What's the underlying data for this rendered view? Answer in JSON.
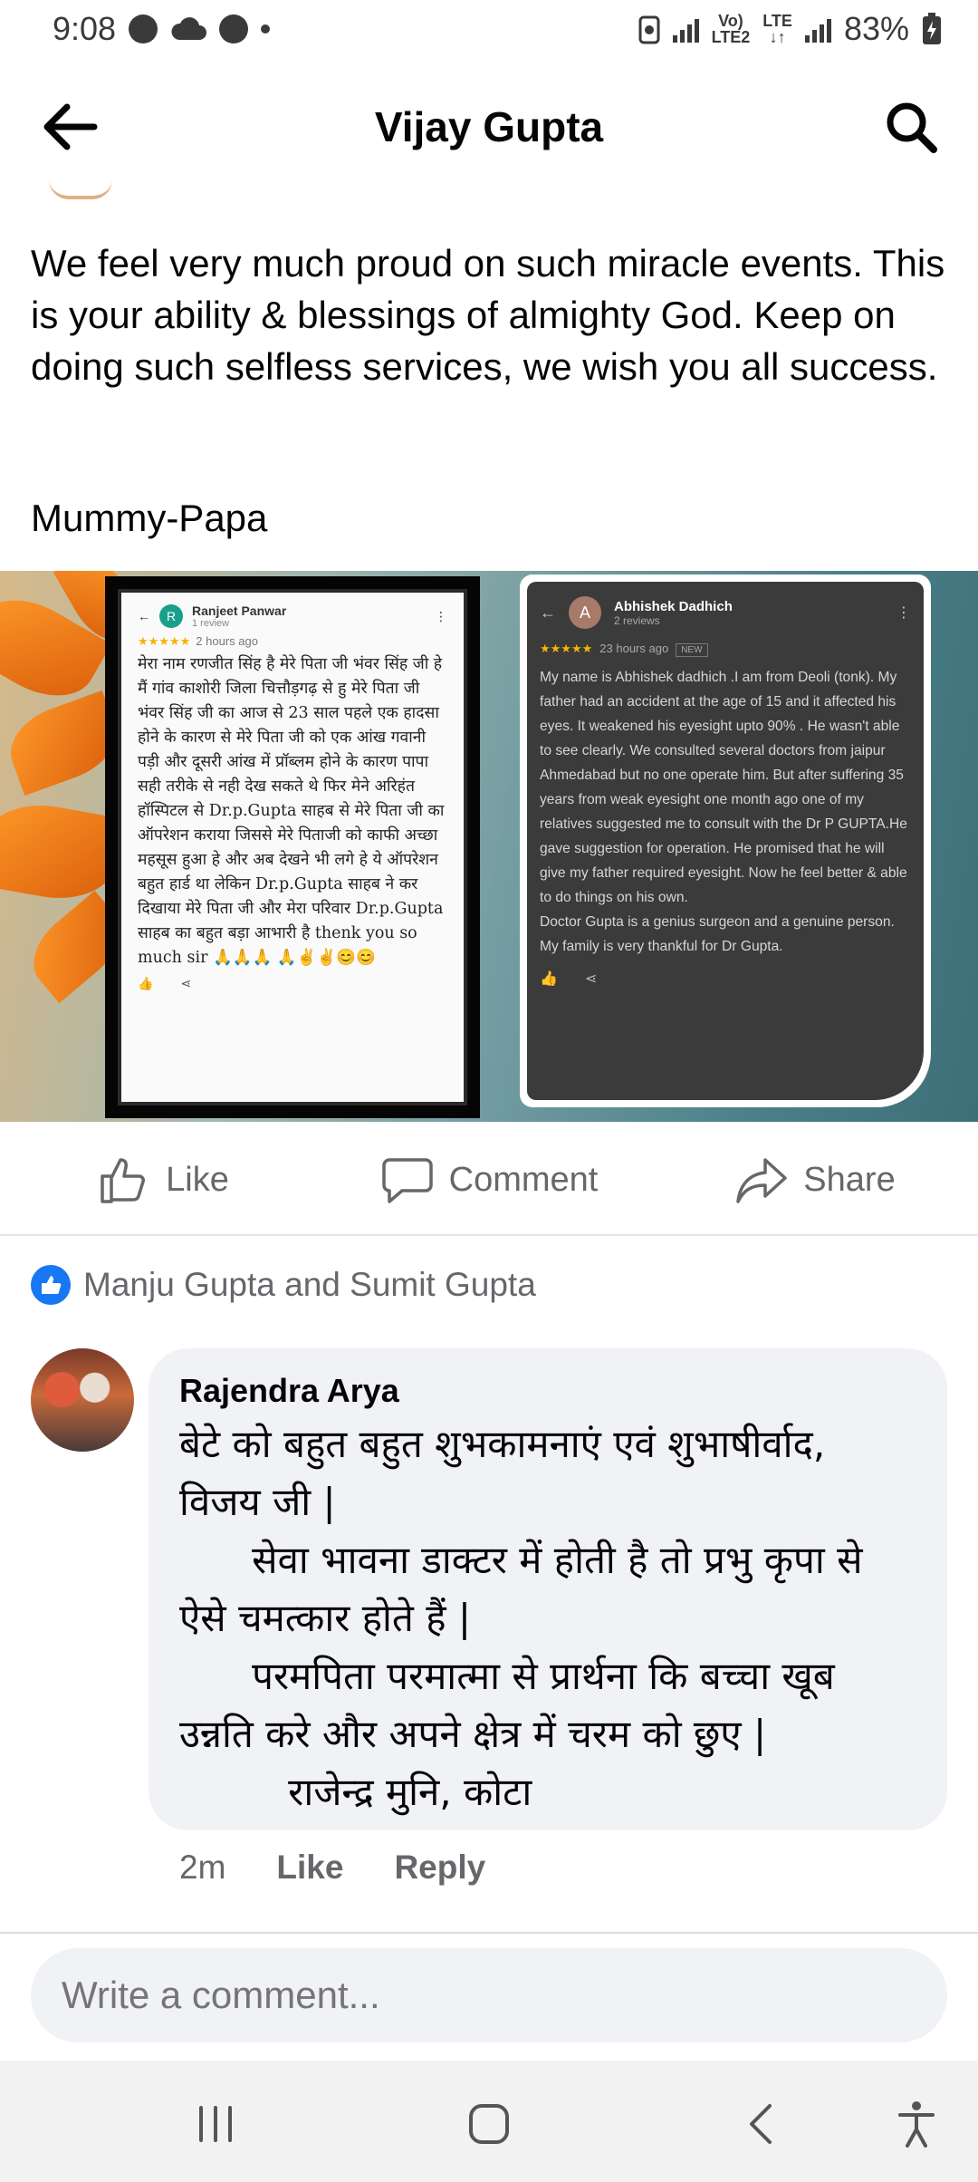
{
  "status_bar": {
    "time": "9:08",
    "network_label_top": "Vo)",
    "network_label_bottom": "LTE2",
    "lte_label": "LTE",
    "battery": "83%"
  },
  "header": {
    "title": "Vijay Gupta",
    "back_icon": "arrow-left-icon",
    "search_icon": "search-icon"
  },
  "post": {
    "text": "We feel very much proud on such miracle events. This is your ability & blessings of almighty God. Keep on doing such selfless services, we wish you all success.",
    "signature": "Mummy-Papa",
    "image": {
      "review1": {
        "avatar_letter": "R",
        "name": "Ranjeet Panwar",
        "reviews": "1 review",
        "stars": "★★★★★",
        "time": "2 hours ago",
        "text": "मेरा नाम रणजीत सिंह है मेरे पिता जी भंवर सिंह जी हे मैं गांव काशोरी जिला चित्तौड़गढ़ से हु मेरे पिता जी भंवर सिंह जी का आज से 23 साल पहले एक हादसा होने के कारण से मेरे पिता जी को एक आंख गवानी पड़ी और दूसरी आंख में प्रॉब्लम होने के कारण पापा सही तरीके से नही देख सकते थे फिर मेने अरिहंत हॉस्पिटल से Dr.p.Gupta साहब से मेरे पिता जी का ऑपरेशन कराया जिससे मेरे पिताजी को काफी अच्छा महसूस हुआ हे और अब देखने भी लगे हे ये ऑपरेशन बहुत हार्ड था लेकिन Dr.p.Gupta साहब ने कर दिखाया मेरे पिता जी और मेरा परिवार Dr.p.Gupta साहब का बहुत बड़ा आभारी है thenk you so much sir 🙏🙏🙏 🙏✌✌😊😊"
      },
      "review2": {
        "avatar_letter": "A",
        "name": "Abhishek Dadhich",
        "reviews": "2 reviews",
        "stars": "★★★★★",
        "time": "23 hours ago",
        "badge": "NEW",
        "text": "My name is Abhishek dadhich .I am from Deoli (tonk). My father had an accident at the age of 15 and it affected his eyes. It weakened his eyesight upto 90% . He wasn't able to see clearly. We consulted several doctors from jaipur Ahmedabad but no one operate him. But after suffering 35 years from weak eyesight one month ago one of my relatives suggested me to consult with the Dr P GUPTA.He gave suggestion for operation. He promised that he will give my father required eyesight. Now he feel better & able to do things on his own.\nDoctor Gupta is a genius surgeon and a genuine person.\nMy family is very thankful for Dr Gupta."
      }
    }
  },
  "actions": {
    "like": "Like",
    "comment": "Comment",
    "share": "Share"
  },
  "reactions": {
    "likers": "Manju Gupta and Sumit Gupta"
  },
  "comment": {
    "author": "Rajendra Arya",
    "text": "बेटे को बहुत बहुत शुभकामनाएं एवं शुभाषीर्वाद, विजय जी |\n      सेवा भावना डाक्टर में होती है तो प्रभु कृपा से ऐसे चमत्कार होते हैं |\n      परमपिता परमात्मा से प्रार्थना कि बच्चा खूब उन्नति करे और अपने क्षेत्र में चरम को छुए |\n         राजेन्द्र मुनि, कोटा",
    "time": "2m",
    "like": "Like",
    "reply": "Reply"
  },
  "composer": {
    "placeholder": "Write a comment..."
  },
  "colors": {
    "accent": "#1877f2",
    "secondary_text": "#65676b",
    "bubble": "#f0f2f5"
  }
}
